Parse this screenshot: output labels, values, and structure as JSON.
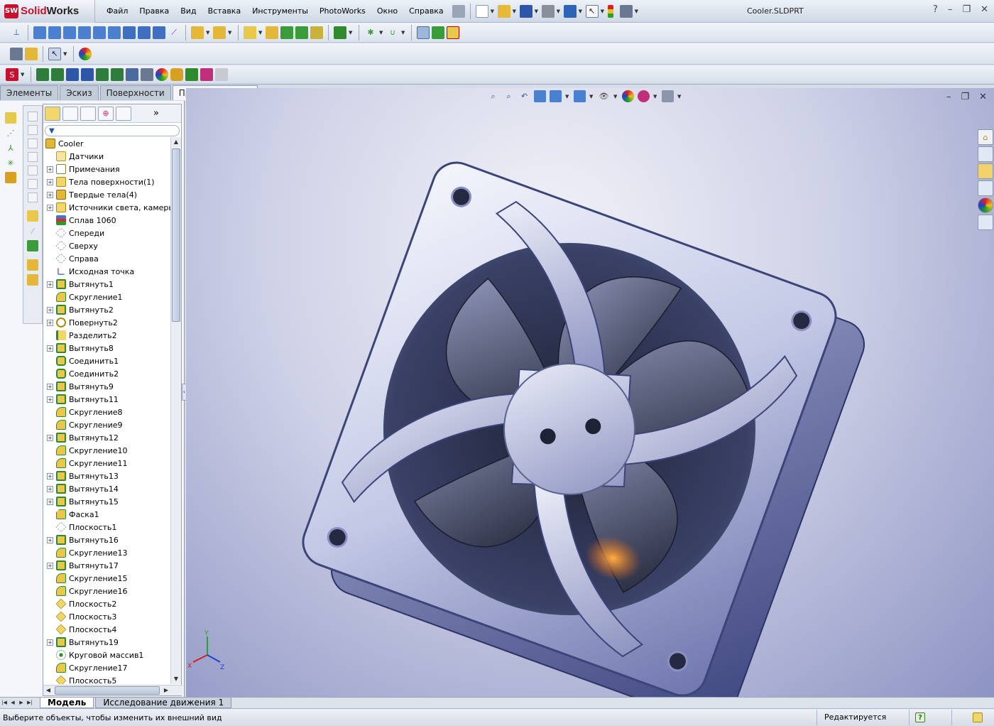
{
  "app": {
    "brand_solid": "Solid",
    "brand_works": "Works",
    "logo_mark": "SW",
    "document_title": "Cooler.SLDPRT",
    "help_symbol": "?"
  },
  "menu": [
    "Файл",
    "Правка",
    "Вид",
    "Вставка",
    "Инструменты",
    "PhotoWorks",
    "Окно",
    "Справка"
  ],
  "command_tabs": [
    {
      "label": "Элементы",
      "active": false
    },
    {
      "label": "Эскиз",
      "active": false
    },
    {
      "label": "Поверхности",
      "active": false
    },
    {
      "label": "Продукты Office",
      "active": true
    }
  ],
  "feature_manager": {
    "more_symbol": "»",
    "root": "Cooler",
    "items": [
      {
        "label": "Датчики",
        "expand": false,
        "icon": "sensor"
      },
      {
        "label": "Примечания",
        "expand": true,
        "icon": "annotation"
      },
      {
        "label": "Тела поверхности(1)",
        "expand": true,
        "icon": "surface"
      },
      {
        "label": "Твердые тела(4)",
        "expand": true,
        "icon": "solid"
      },
      {
        "label": "Источники света, камеры и",
        "expand": true,
        "icon": "light"
      },
      {
        "label": "Сплав 1060",
        "expand": false,
        "icon": "material"
      },
      {
        "label": "Спереди",
        "expand": false,
        "icon": "plane"
      },
      {
        "label": "Сверху",
        "expand": false,
        "icon": "plane"
      },
      {
        "label": "Справа",
        "expand": false,
        "icon": "plane"
      },
      {
        "label": "Исходная точка",
        "expand": false,
        "icon": "origin"
      },
      {
        "label": "Вытянуть1",
        "expand": true,
        "icon": "extrude"
      },
      {
        "label": "Скругление1",
        "expand": false,
        "icon": "fillet"
      },
      {
        "label": "Вытянуть2",
        "expand": true,
        "icon": "extrude"
      },
      {
        "label": "Повернуть2",
        "expand": true,
        "icon": "revolve"
      },
      {
        "label": "Разделить2",
        "expand": false,
        "icon": "split"
      },
      {
        "label": "Вытянуть8",
        "expand": true,
        "icon": "extrude"
      },
      {
        "label": "Соединить1",
        "expand": false,
        "icon": "combine"
      },
      {
        "label": "Соединить2",
        "expand": false,
        "icon": "combine"
      },
      {
        "label": "Вытянуть9",
        "expand": true,
        "icon": "extrude"
      },
      {
        "label": "Вытянуть11",
        "expand": true,
        "icon": "extrude"
      },
      {
        "label": "Скругление8",
        "expand": false,
        "icon": "fillet"
      },
      {
        "label": "Скругление9",
        "expand": false,
        "icon": "fillet"
      },
      {
        "label": "Вытянуть12",
        "expand": true,
        "icon": "extrude"
      },
      {
        "label": "Скругление10",
        "expand": false,
        "icon": "fillet"
      },
      {
        "label": "Скругление11",
        "expand": false,
        "icon": "fillet"
      },
      {
        "label": "Вытянуть13",
        "expand": true,
        "icon": "extrude"
      },
      {
        "label": "Вытянуть14",
        "expand": true,
        "icon": "extrude"
      },
      {
        "label": "Вытянуть15",
        "expand": true,
        "icon": "extrude"
      },
      {
        "label": "Фаска1",
        "expand": false,
        "icon": "chamfer"
      },
      {
        "label": "Плоскость1",
        "expand": false,
        "icon": "plane"
      },
      {
        "label": "Вытянуть16",
        "expand": true,
        "icon": "extrude"
      },
      {
        "label": "Скругление13",
        "expand": false,
        "icon": "fillet"
      },
      {
        "label": "Вытянуть17",
        "expand": true,
        "icon": "extrude"
      },
      {
        "label": "Скругление15",
        "expand": false,
        "icon": "fillet"
      },
      {
        "label": "Скругление16",
        "expand": false,
        "icon": "fillet"
      },
      {
        "label": "Плоскость2",
        "expand": false,
        "icon": "plane-y"
      },
      {
        "label": "Плоскость3",
        "expand": false,
        "icon": "plane-y"
      },
      {
        "label": "Плоскость4",
        "expand": false,
        "icon": "plane-y"
      },
      {
        "label": "Вытянуть19",
        "expand": true,
        "icon": "extrude"
      },
      {
        "label": "Круговой массив1",
        "expand": false,
        "icon": "pattern"
      },
      {
        "label": "Скругление17",
        "expand": false,
        "icon": "fillet"
      },
      {
        "label": "Плоскость5",
        "expand": false,
        "icon": "plane-y"
      }
    ]
  },
  "triad": {
    "x": "X",
    "y": "Y",
    "z": "Z"
  },
  "bottom_tabs": [
    {
      "label": "Модель",
      "active": true
    },
    {
      "label": "Исследование движения 1",
      "active": false
    }
  ],
  "status": {
    "message": "Выберите объекты, чтобы изменить их внешний вид",
    "mode": "Редактируется Деталь"
  },
  "colors": {
    "accent_red": "#c8102e",
    "feature_yellow": "#e8c84a",
    "feature_green": "#3a9b3a",
    "viewport_blue": "#8d93c3"
  }
}
